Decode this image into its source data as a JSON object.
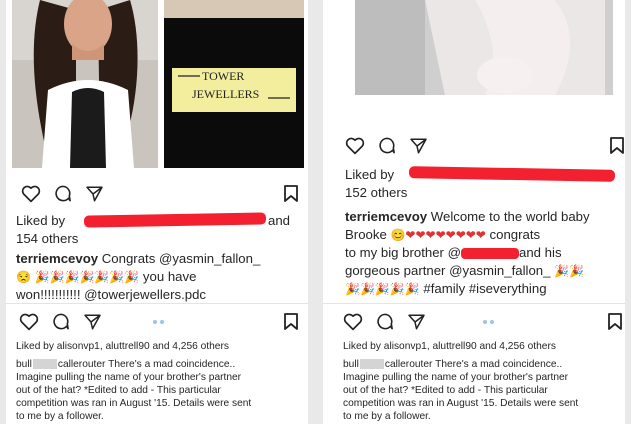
{
  "colors": {
    "accent_red": "#f3202f",
    "dot_blue": "#9bc3e6"
  },
  "left": {
    "ad_logo": "TOWER\nJEWELLERS",
    "actions": [
      "heart-icon",
      "comment-icon",
      "share-icon",
      "bookmark-icon"
    ],
    "liked_prefix": "Liked by",
    "liked_suffix": "and",
    "others": "154 others",
    "user": "terriemcevoy",
    "caption_line1": "Congrats @yasmin_fallon_",
    "caption_line2_tail": "you have",
    "caption_line3": "won!!!!!!!!!!! @towerjewellers.pdc"
  },
  "right": {
    "actions": [
      "heart-icon",
      "comment-icon",
      "share-icon",
      "bookmark-icon"
    ],
    "liked_prefix": "Liked by",
    "others": "152 others",
    "user": "terriemcevoy",
    "caption_line1": "Welcome to the world baby",
    "caption_line2_head": "Brooke",
    "caption_line2_tail": "congrats",
    "caption_line3_head": "to my big brother @",
    "caption_line3_tail": "and his",
    "caption_line4": "gorgeous partner @yasmin_fallon_",
    "caption_line5": "#family #iseverything"
  },
  "comment": {
    "liked": "Liked by alisonvp1, aluttrell90 and 4,256 others",
    "user_a": "bull",
    "user_b": "callerouter",
    "text1": "There's a mad coincidence..",
    "text2": "Imagine pulling the name of your brother's partner",
    "text3": "out of the hat? *Edited to add - This particular",
    "text4": "competition was ran in August '15. Details were sent",
    "text5": "to me by a follower."
  }
}
